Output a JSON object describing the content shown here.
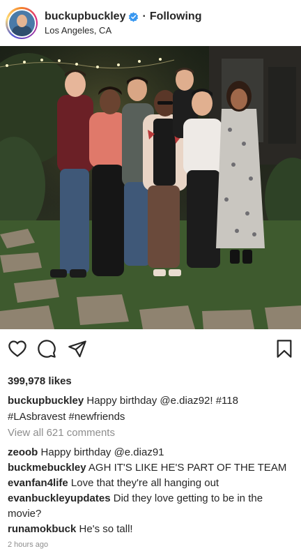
{
  "post": {
    "username": "buckupbuckley",
    "follow_status": "Following",
    "separator": "·",
    "location": "Los Angeles, CA",
    "verified": true,
    "likes": "399,978 likes",
    "caption_user": "buckupbuckley",
    "caption_text": "Happy birthday @e.diaz92! #118 #LAsbravest #newfriends",
    "view_all": "View all 621 comments",
    "comments": [
      {
        "user": "zeoob",
        "text": "Happy birthday @e.diaz91"
      },
      {
        "user": "buckmebuckley",
        "text": "AGH IT'S LIKE HE'S PART OF THE TEAM"
      },
      {
        "user": "evanfan4life",
        "text": "Love that they're all hanging out"
      },
      {
        "user": "evanbuckleyupdates",
        "text": "Did they love getting to be in the movie?"
      },
      {
        "user": "runamokbuck",
        "text": "He's so tall!"
      }
    ],
    "timestamp": "2 hours ago"
  },
  "icons": {
    "like": "heart-icon",
    "comment": "comment-bubble-icon",
    "share": "paper-plane-icon",
    "save": "bookmark-icon",
    "verified": "verified-badge-icon"
  },
  "colors": {
    "text": "#262626",
    "muted": "#8e8e8e",
    "verified_blue": "#3897f0"
  }
}
